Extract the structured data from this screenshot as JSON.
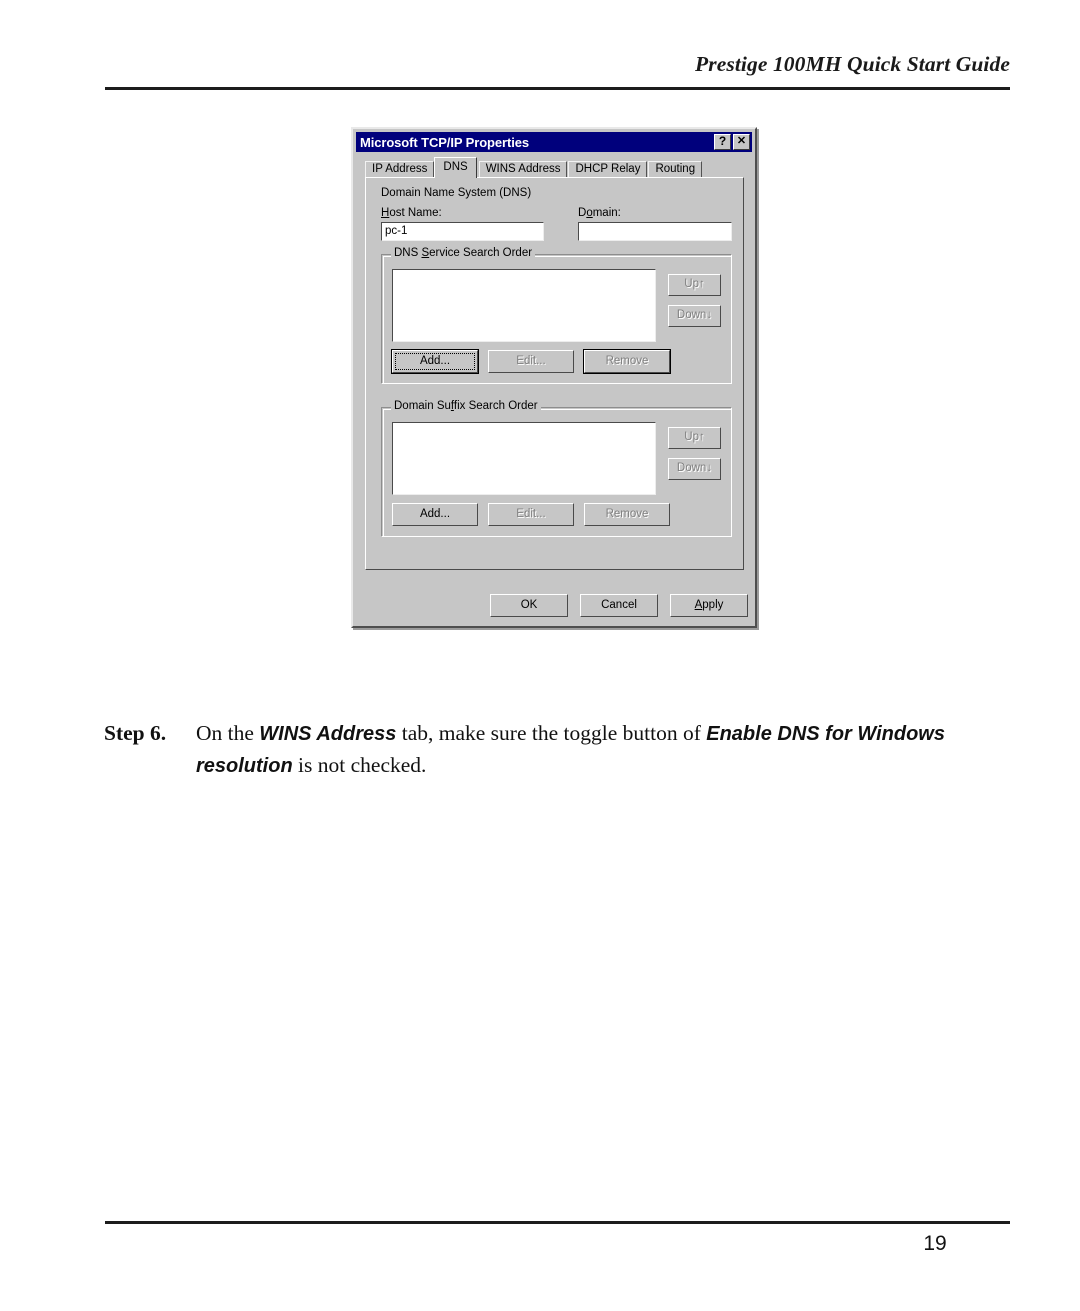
{
  "document": {
    "header_title": "Prestige 100MH Quick Start Guide",
    "page_number": "19"
  },
  "step": {
    "label": "Step 6.",
    "text_part_1": "On the ",
    "emphasis_1": "WINS Address",
    "text_part_2": " tab, make sure the toggle button of ",
    "emphasis_2": "Enable DNS for Windows resolution",
    "text_part_3": " is not checked."
  },
  "dialog": {
    "title": "Microsoft TCP/IP Properties",
    "help_button": "?",
    "close_button": "✕",
    "tabs": [
      {
        "label": "IP Address",
        "active": false
      },
      {
        "label": "DNS",
        "active": true
      },
      {
        "label": "WINS Address",
        "active": false
      },
      {
        "label": "DHCP Relay",
        "active": false
      },
      {
        "label": "Routing",
        "active": false
      }
    ],
    "dns_panel": {
      "section_title": "Domain Name System (DNS)",
      "host_name_label": "Host Name:",
      "host_name_value": "pc-1",
      "domain_label": "Domain:",
      "domain_value": "",
      "service_group": {
        "legend": "DNS Service Search Order",
        "items": [],
        "up_button": "Up↑",
        "down_button": "Down↓",
        "add_button": "Add...",
        "edit_button": "Edit...",
        "remove_button": "Remove"
      },
      "suffix_group": {
        "legend": "Domain Suffix Search Order",
        "items": [],
        "up_button": "Up↑",
        "down_button": "Down↓",
        "add_button": "Add...",
        "edit_button": "Edit...",
        "remove_button": "Remove"
      }
    },
    "footer_buttons": {
      "ok": "OK",
      "cancel": "Cancel",
      "apply": "Apply"
    }
  },
  "colors": {
    "titlebar": "#00007c",
    "dialog_face": "#c6c6c6",
    "field_background": "#ffffff",
    "disabled_text": "#808080"
  }
}
